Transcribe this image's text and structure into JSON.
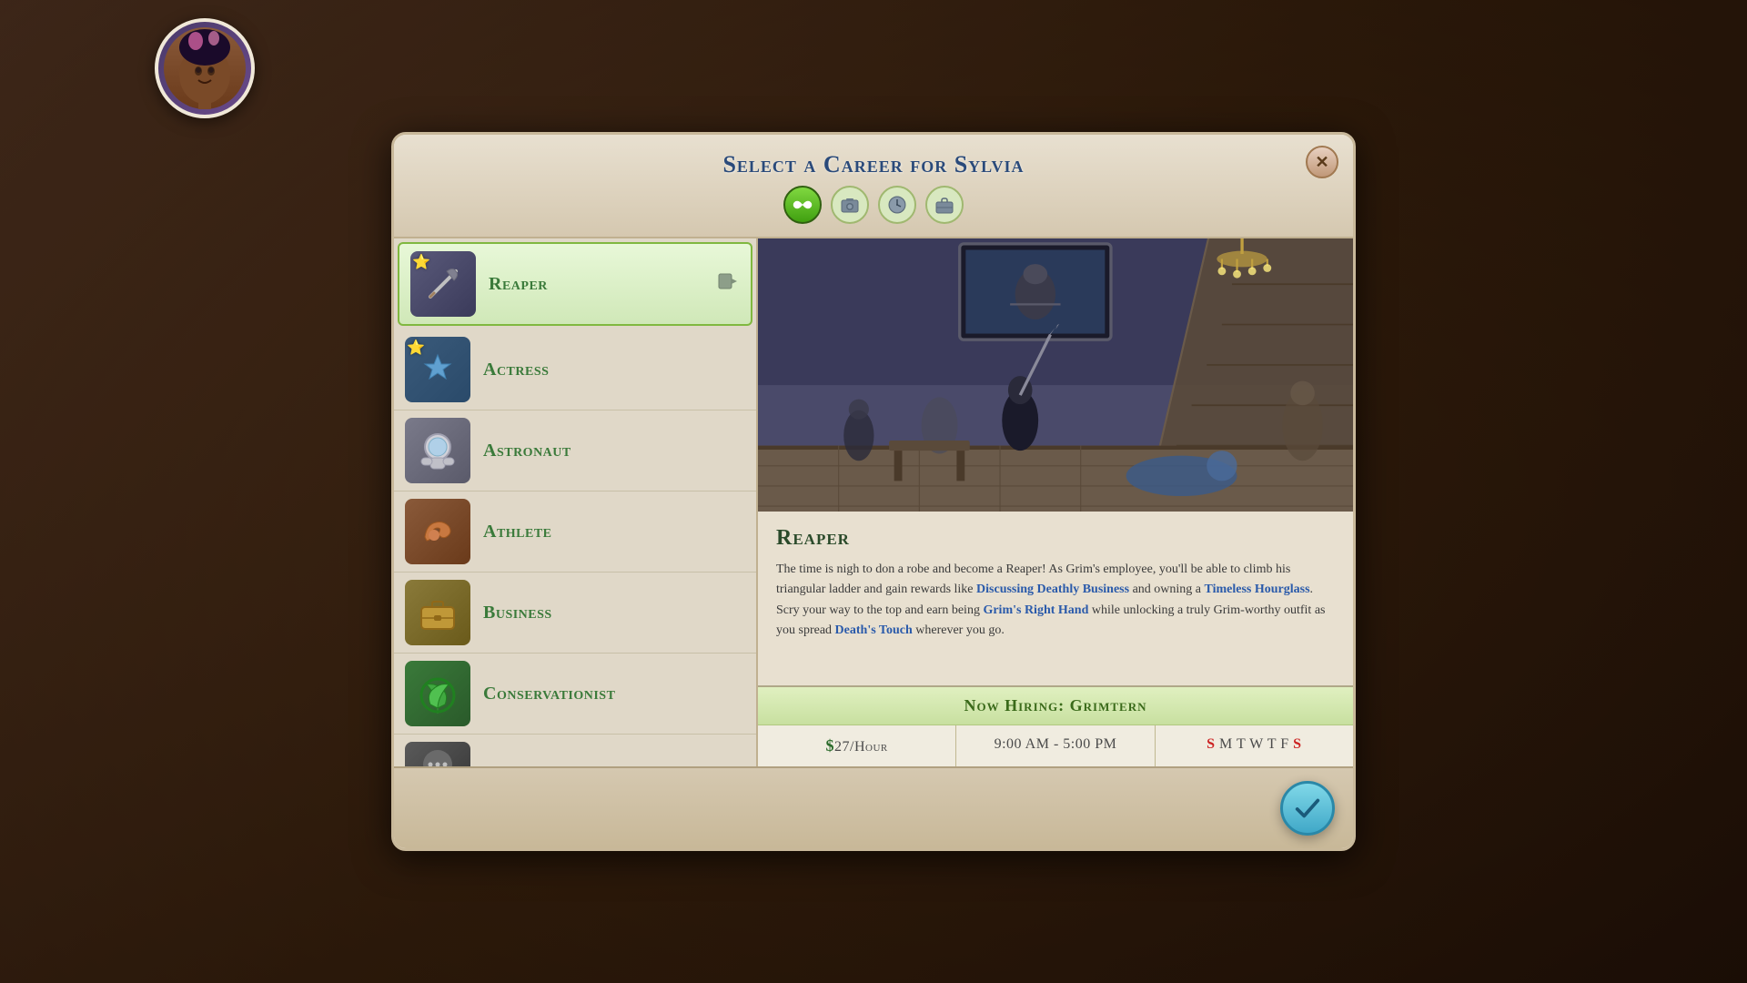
{
  "app": {
    "bg_color": "#2a1a0e"
  },
  "modal": {
    "title": "Select a Career for Sylvia",
    "close_label": "✕"
  },
  "filter_icons": [
    {
      "id": "all",
      "icon": "∞",
      "active": true,
      "label": "All"
    },
    {
      "id": "work",
      "icon": "📷",
      "active": false,
      "label": "Work"
    },
    {
      "id": "clock",
      "icon": "⏱",
      "active": false,
      "label": "Schedule"
    },
    {
      "id": "briefcase",
      "icon": "💼",
      "active": false,
      "label": "Careers"
    }
  ],
  "careers": [
    {
      "id": "reaper",
      "name": "Reaper",
      "icon": "⚒",
      "has_star": true,
      "selected": true,
      "action_icon": "▶"
    },
    {
      "id": "actress",
      "name": "Actress",
      "icon": "💎",
      "has_star": true,
      "selected": false
    },
    {
      "id": "astronaut",
      "name": "Astronaut",
      "icon": "🚀",
      "has_star": false,
      "selected": false
    },
    {
      "id": "athlete",
      "name": "Athlete",
      "icon": "💪",
      "has_star": false,
      "selected": false
    },
    {
      "id": "business",
      "name": "Business",
      "icon": "💼",
      "has_star": false,
      "selected": false
    },
    {
      "id": "conservationist",
      "name": "Conservationist",
      "icon": "🌿",
      "has_star": false,
      "selected": false
    },
    {
      "id": "more",
      "name": "...",
      "icon": "⚙",
      "has_star": false,
      "selected": false
    }
  ],
  "career_detail": {
    "name": "Reaper",
    "description_parts": [
      {
        "text": "The time is nigh to don a robe and become a Reaper! As Grim's employee, you'll be able to climb his triangular ladder and gain rewards like "
      },
      {
        "text": "Discussing Deathly Business",
        "highlight": true
      },
      {
        "text": " and owning a "
      },
      {
        "text": "Timeless Hourglass",
        "highlight": true
      },
      {
        "text": ". Scry your way to the top and earn being "
      },
      {
        "text": "Grim's Right Hand",
        "highlight": true
      },
      {
        "text": " while unlocking a truly Grim-worthy outfit as you spread "
      },
      {
        "text": "Death's Touch",
        "highlight": true
      },
      {
        "text": " wherever you go."
      }
    ]
  },
  "hiring": {
    "banner": "Now Hiring: Grimtern",
    "wage": "$27/Hour",
    "wage_symbol": "$",
    "wage_amount": "27/Hour",
    "hours": "9:00 AM - 5:00 PM",
    "days": [
      {
        "label": "S",
        "off": true
      },
      {
        "label": "M",
        "off": false
      },
      {
        "label": "T",
        "off": false
      },
      {
        "label": "W",
        "off": false
      },
      {
        "label": "T",
        "off": false
      },
      {
        "label": "F",
        "off": false
      },
      {
        "label": "S",
        "off": true
      }
    ]
  },
  "confirm_button": {
    "label": "✓",
    "aria": "Confirm career selection"
  }
}
